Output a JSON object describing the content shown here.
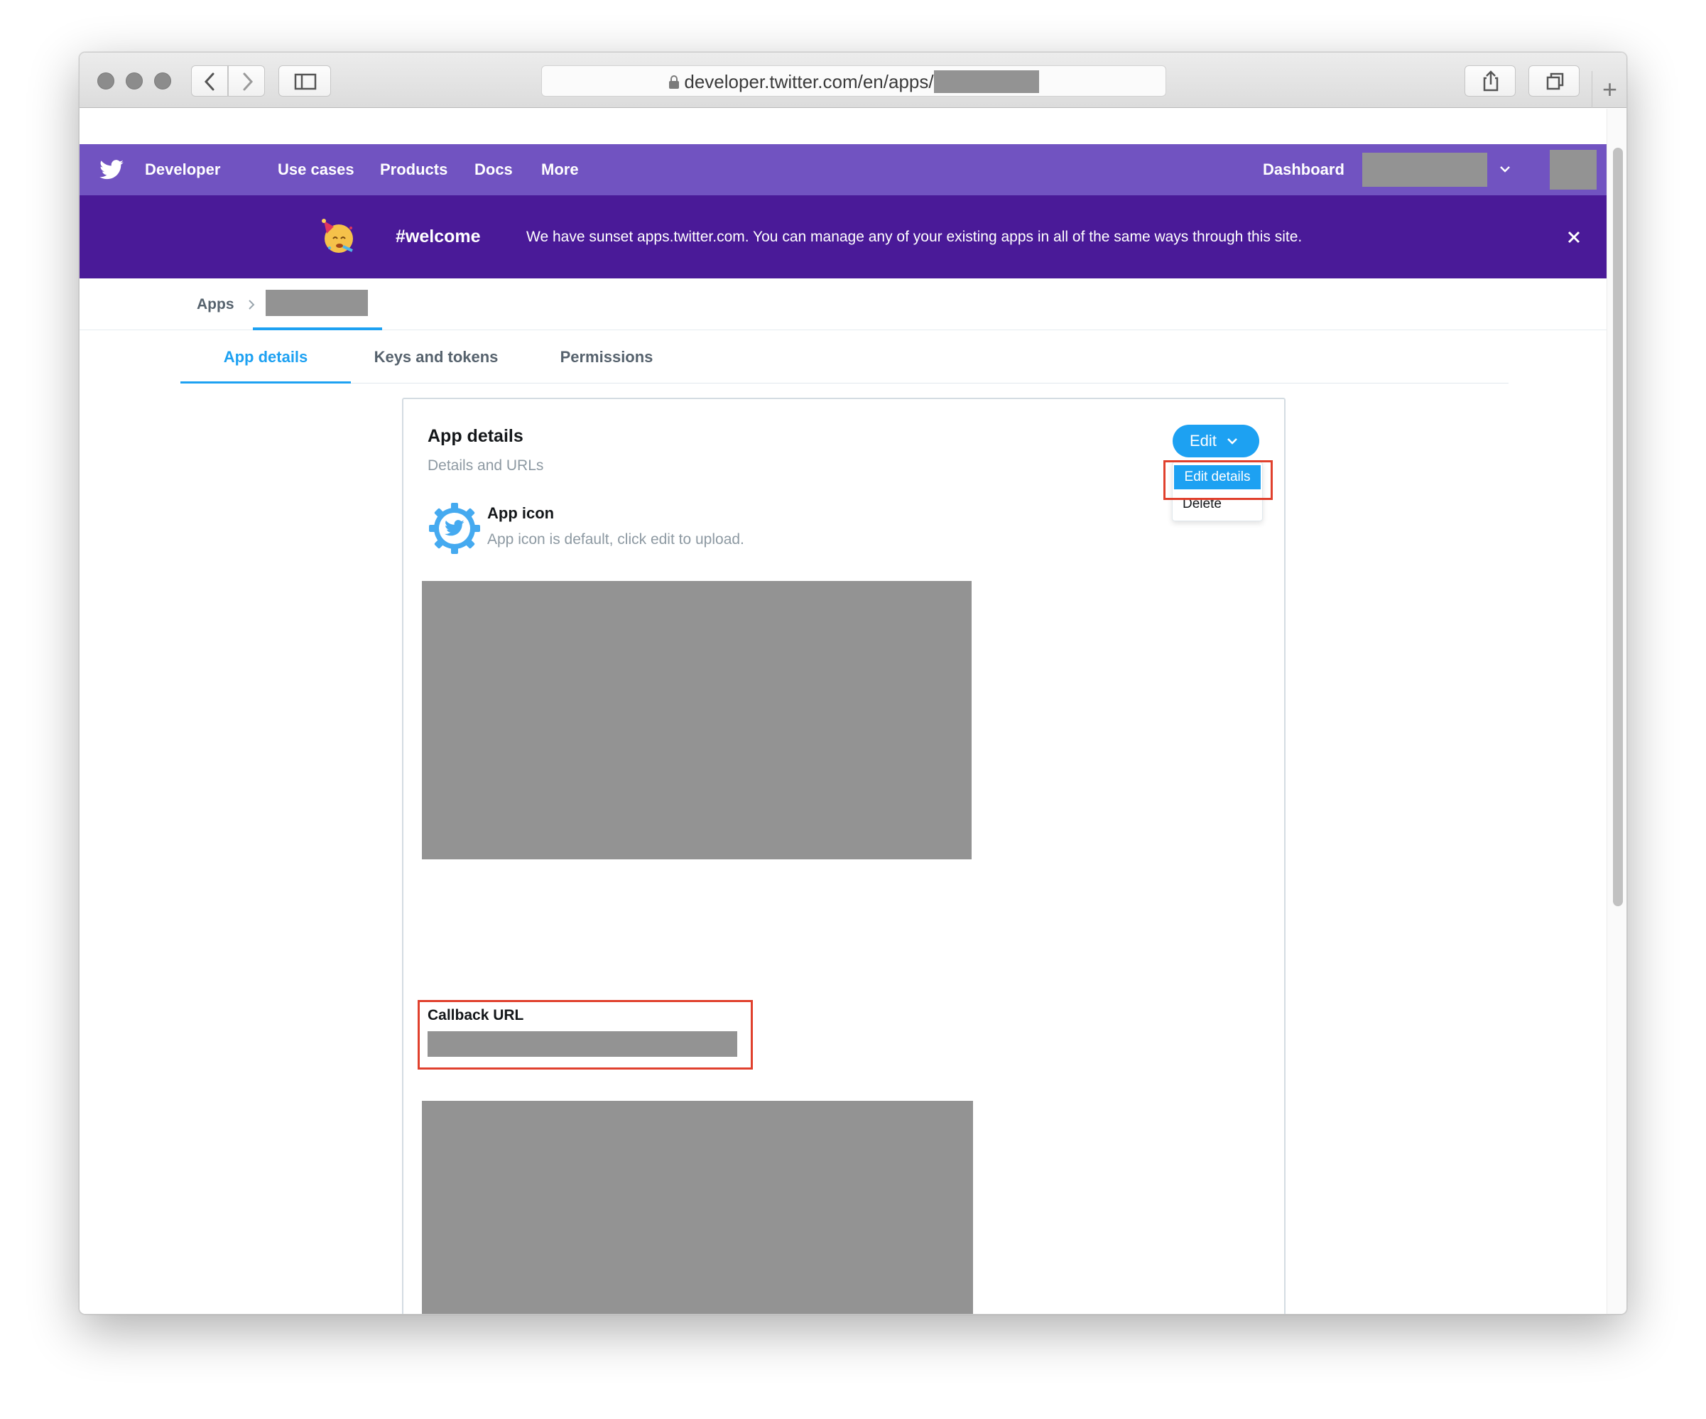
{
  "browser": {
    "url_text": "developer.twitter.com/en/apps/",
    "icons": [
      "back-arrow-icon",
      "forward-arrow-icon",
      "sidebar-icon",
      "lock-icon",
      "share-icon",
      "tabs-icon",
      "plus-icon"
    ]
  },
  "topnav": {
    "brand": "Developer",
    "links": [
      "Use cases",
      "Products",
      "Docs",
      "More"
    ],
    "dashboard": "Dashboard"
  },
  "banner": {
    "tag": "#welcome",
    "message": "We have sunset apps.twitter.com. You can manage any of your existing apps in all of the same ways through this site."
  },
  "breadcrumb": {
    "root": "Apps"
  },
  "tabs": [
    "App details",
    "Keys and tokens",
    "Permissions"
  ],
  "card": {
    "title": "App details",
    "subtitle": "Details and URLs",
    "edit_button": "Edit",
    "menu": {
      "edit_details": "Edit details",
      "delete": "Delete"
    },
    "app_icon_title": "App icon",
    "app_icon_desc": "App icon is default, click edit to upload.",
    "callback_label": "Callback URL"
  },
  "colors": {
    "nav_purple": "#7153c1",
    "banner_purple": "#4a1a98",
    "twitter_blue": "#1da1f2",
    "highlight_red": "#e0402d",
    "redaction_gray": "#939393"
  }
}
